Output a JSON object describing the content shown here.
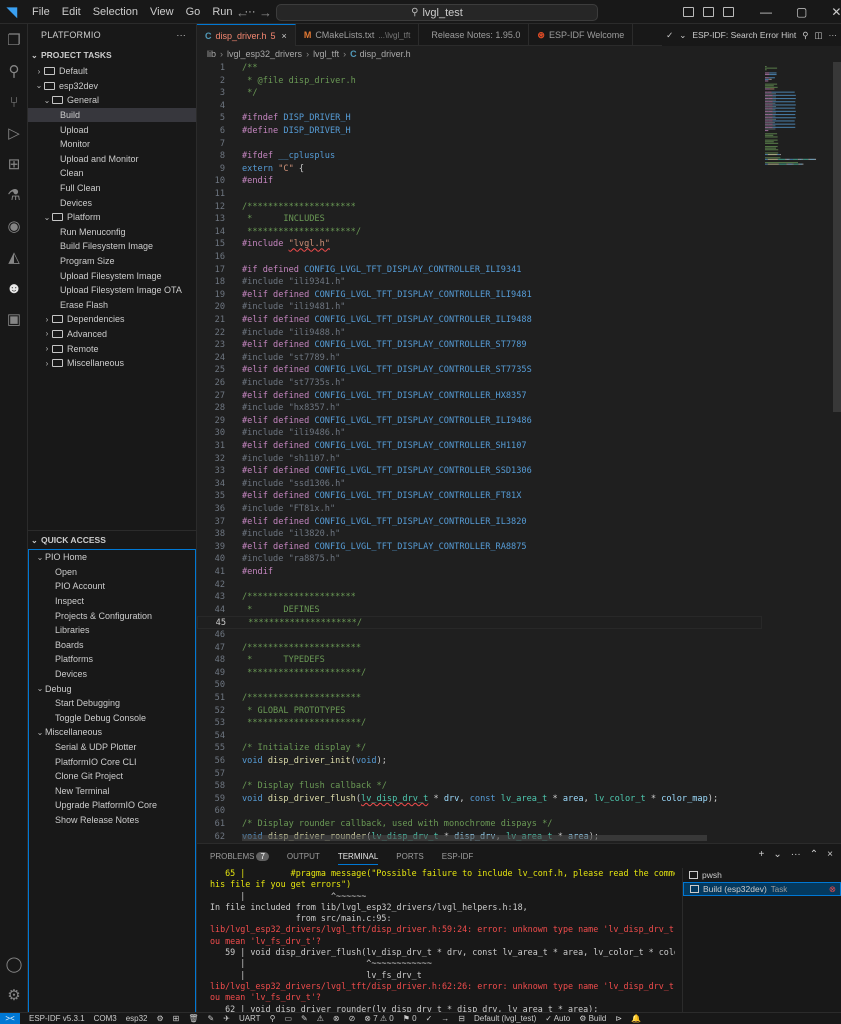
{
  "titlebar": {
    "menus": [
      "File",
      "Edit",
      "Selection",
      "View",
      "Go",
      "Run"
    ],
    "more": "···",
    "search": "lvgl_test"
  },
  "sidebar": {
    "title": "PLATFORMIO",
    "more": "···",
    "project_tasks": {
      "title": "PROJECT TASKS",
      "items": [
        {
          "label": "Default",
          "level": 1,
          "chev": "›",
          "folder": true
        },
        {
          "label": "esp32dev",
          "level": 1,
          "chev": "⌄",
          "folder": true
        },
        {
          "label": "General",
          "level": 2,
          "chev": "⌄",
          "folder": true
        },
        {
          "label": "Build",
          "level": 3,
          "chev": "",
          "folder": false,
          "selected": true
        },
        {
          "label": "Upload",
          "level": 3,
          "chev": "",
          "folder": false
        },
        {
          "label": "Monitor",
          "level": 3,
          "chev": "",
          "folder": false
        },
        {
          "label": "Upload and Monitor",
          "level": 3,
          "chev": "",
          "folder": false
        },
        {
          "label": "Clean",
          "level": 3,
          "chev": "",
          "folder": false
        },
        {
          "label": "Full Clean",
          "level": 3,
          "chev": "",
          "folder": false
        },
        {
          "label": "Devices",
          "level": 3,
          "chev": "",
          "folder": false
        },
        {
          "label": "Platform",
          "level": 2,
          "chev": "⌄",
          "folder": true
        },
        {
          "label": "Run Menuconfig",
          "level": 3,
          "chev": "",
          "folder": false
        },
        {
          "label": "Build Filesystem Image",
          "level": 3,
          "chev": "",
          "folder": false
        },
        {
          "label": "Program Size",
          "level": 3,
          "chev": "",
          "folder": false
        },
        {
          "label": "Upload Filesystem Image",
          "level": 3,
          "chev": "",
          "folder": false
        },
        {
          "label": "Upload Filesystem Image OTA",
          "level": 3,
          "chev": "",
          "folder": false
        },
        {
          "label": "Erase Flash",
          "level": 3,
          "chev": "",
          "folder": false
        },
        {
          "label": "Dependencies",
          "level": 2,
          "chev": "›",
          "folder": true
        },
        {
          "label": "Advanced",
          "level": 2,
          "chev": "›",
          "folder": true
        },
        {
          "label": "Remote",
          "level": 2,
          "chev": "›",
          "folder": true
        },
        {
          "label": "Miscellaneous",
          "level": 2,
          "chev": "›",
          "folder": true
        }
      ]
    },
    "quick_access": {
      "title": "QUICK ACCESS",
      "items": [
        {
          "label": "PIO Home",
          "level": 1,
          "chev": "⌄"
        },
        {
          "label": "Open",
          "level": 2,
          "chev": ""
        },
        {
          "label": "PIO Account",
          "level": 2,
          "chev": ""
        },
        {
          "label": "Inspect",
          "level": 2,
          "chev": ""
        },
        {
          "label": "Projects & Configuration",
          "level": 2,
          "chev": ""
        },
        {
          "label": "Libraries",
          "level": 2,
          "chev": ""
        },
        {
          "label": "Boards",
          "level": 2,
          "chev": ""
        },
        {
          "label": "Platforms",
          "level": 2,
          "chev": ""
        },
        {
          "label": "Devices",
          "level": 2,
          "chev": ""
        },
        {
          "label": "Debug",
          "level": 1,
          "chev": "⌄"
        },
        {
          "label": "Start Debugging",
          "level": 2,
          "chev": ""
        },
        {
          "label": "Toggle Debug Console",
          "level": 2,
          "chev": ""
        },
        {
          "label": "Miscellaneous",
          "level": 1,
          "chev": "⌄"
        },
        {
          "label": "Serial & UDP Plotter",
          "level": 2,
          "chev": ""
        },
        {
          "label": "PlatformIO Core CLI",
          "level": 2,
          "chev": ""
        },
        {
          "label": "Clone Git Project",
          "level": 2,
          "chev": ""
        },
        {
          "label": "New Terminal",
          "level": 2,
          "chev": ""
        },
        {
          "label": "Upgrade PlatformIO Core",
          "level": 2,
          "chev": ""
        },
        {
          "label": "Show Release Notes",
          "level": 2,
          "chev": ""
        }
      ]
    }
  },
  "tabs": [
    {
      "icon": "C",
      "icon_color": "#519aba",
      "label": "disp_driver.h",
      "badge": "5",
      "desc": "",
      "active": true,
      "close": "×"
    },
    {
      "icon": "M",
      "icon_color": "#e37933",
      "label": "CMakeLists.txt",
      "badge": "",
      "desc": "...\\lvgl_tft",
      "active": false,
      "close": ""
    },
    {
      "icon": "",
      "icon_color": "#cccccc",
      "label": "Release Notes: 1.95.0",
      "badge": "",
      "desc": "",
      "active": false,
      "close": ""
    },
    {
      "icon": "",
      "icon_color": "#e34c26",
      "label": "ESP-IDF Welcome",
      "badge": "",
      "desc": "",
      "active": false,
      "close": ""
    }
  ],
  "tab_actions": {
    "label": "ESP-IDF: Search Error Hint"
  },
  "breadcrumb": [
    "lib",
    "lvgl_esp32_drivers",
    "lvgl_tft",
    "disp_driver.h"
  ],
  "breadcrumb_sep": "›",
  "editor": {
    "current_line": 45,
    "lines": [
      [
        {
          "t": "/**",
          "c": "com"
        }
      ],
      [
        {
          "t": " * @file disp_driver.h",
          "c": "com"
        }
      ],
      [
        {
          "t": " */",
          "c": "com"
        }
      ],
      [],
      [
        {
          "t": "#ifndef ",
          "c": "pp"
        },
        {
          "t": "DISP_DRIVER_H",
          "c": "mac"
        }
      ],
      [
        {
          "t": "#define ",
          "c": "pp"
        },
        {
          "t": "DISP_DRIVER_H",
          "c": "mac"
        }
      ],
      [],
      [
        {
          "t": "#ifdef ",
          "c": "pp"
        },
        {
          "t": "__cplusplus",
          "c": "mac"
        }
      ],
      [
        {
          "t": "extern ",
          "c": "kw"
        },
        {
          "t": "\"C\"",
          "c": "str"
        },
        {
          "t": " {",
          "c": "plain"
        }
      ],
      [
        {
          "t": "#endif",
          "c": "pp"
        }
      ],
      [],
      [
        {
          "t": "/*********************",
          "c": "com"
        }
      ],
      [
        {
          "t": " *      INCLUDES",
          "c": "com"
        }
      ],
      [
        {
          "t": " *********************/",
          "c": "com"
        }
      ],
      [
        {
          "t": "#include ",
          "c": "pp"
        },
        {
          "t": "\"lvgl.h\"",
          "c": "str",
          "sq": true
        }
      ],
      [],
      [
        {
          "t": "#if ",
          "c": "pp"
        },
        {
          "t": "defined ",
          "c": "pp"
        },
        {
          "t": "CONFIG_LVGL_TFT_DISPLAY_CONTROLLER_ILI9341",
          "c": "mac"
        }
      ],
      [
        {
          "t": "#include \"ili9341.h\"",
          "c": "inc"
        }
      ],
      [
        {
          "t": "#elif ",
          "c": "pp"
        },
        {
          "t": "defined ",
          "c": "pp"
        },
        {
          "t": "CONFIG_LVGL_TFT_DISPLAY_CONTROLLER_ILI9481",
          "c": "mac"
        }
      ],
      [
        {
          "t": "#include \"ili9481.h\"",
          "c": "inc"
        }
      ],
      [
        {
          "t": "#elif ",
          "c": "pp"
        },
        {
          "t": "defined ",
          "c": "pp"
        },
        {
          "t": "CONFIG_LVGL_TFT_DISPLAY_CONTROLLER_ILI9488",
          "c": "mac"
        }
      ],
      [
        {
          "t": "#include \"ili9488.h\"",
          "c": "inc"
        }
      ],
      [
        {
          "t": "#elif ",
          "c": "pp"
        },
        {
          "t": "defined ",
          "c": "pp"
        },
        {
          "t": "CONFIG_LVGL_TFT_DISPLAY_CONTROLLER_ST7789",
          "c": "mac"
        }
      ],
      [
        {
          "t": "#include \"st7789.h\"",
          "c": "inc"
        }
      ],
      [
        {
          "t": "#elif ",
          "c": "pp"
        },
        {
          "t": "defined ",
          "c": "pp"
        },
        {
          "t": "CONFIG_LVGL_TFT_DISPLAY_CONTROLLER_ST7735S",
          "c": "mac"
        }
      ],
      [
        {
          "t": "#include \"st7735s.h\"",
          "c": "inc"
        }
      ],
      [
        {
          "t": "#elif ",
          "c": "pp"
        },
        {
          "t": "defined ",
          "c": "pp"
        },
        {
          "t": "CONFIG_LVGL_TFT_DISPLAY_CONTROLLER_HX8357",
          "c": "mac"
        }
      ],
      [
        {
          "t": "#include \"hx8357.h\"",
          "c": "inc"
        }
      ],
      [
        {
          "t": "#elif ",
          "c": "pp"
        },
        {
          "t": "defined ",
          "c": "pp"
        },
        {
          "t": "CONFIG_LVGL_TFT_DISPLAY_CONTROLLER_ILI9486",
          "c": "mac"
        }
      ],
      [
        {
          "t": "#include \"ili9486.h\"",
          "c": "inc"
        }
      ],
      [
        {
          "t": "#elif ",
          "c": "pp"
        },
        {
          "t": "defined ",
          "c": "pp"
        },
        {
          "t": "CONFIG_LVGL_TFT_DISPLAY_CONTROLLER_SH1107",
          "c": "mac"
        }
      ],
      [
        {
          "t": "#include \"sh1107.h\"",
          "c": "inc"
        }
      ],
      [
        {
          "t": "#elif ",
          "c": "pp"
        },
        {
          "t": "defined ",
          "c": "pp"
        },
        {
          "t": "CONFIG_LVGL_TFT_DISPLAY_CONTROLLER_SSD1306",
          "c": "mac"
        }
      ],
      [
        {
          "t": "#include \"ssd1306.h\"",
          "c": "inc"
        }
      ],
      [
        {
          "t": "#elif ",
          "c": "pp"
        },
        {
          "t": "defined ",
          "c": "pp"
        },
        {
          "t": "CONFIG_LVGL_TFT_DISPLAY_CONTROLLER_FT81X",
          "c": "mac"
        }
      ],
      [
        {
          "t": "#include \"FT81x.h\"",
          "c": "inc"
        }
      ],
      [
        {
          "t": "#elif ",
          "c": "pp"
        },
        {
          "t": "defined ",
          "c": "pp"
        },
        {
          "t": "CONFIG_LVGL_TFT_DISPLAY_CONTROLLER_IL3820",
          "c": "mac"
        }
      ],
      [
        {
          "t": "#include \"il3820.h\"",
          "c": "inc"
        }
      ],
      [
        {
          "t": "#elif ",
          "c": "pp"
        },
        {
          "t": "defined ",
          "c": "pp"
        },
        {
          "t": "CONFIG_LVGL_TFT_DISPLAY_CONTROLLER_RA8875",
          "c": "mac"
        }
      ],
      [
        {
          "t": "#include \"ra8875.h\"",
          "c": "inc"
        }
      ],
      [
        {
          "t": "#endif",
          "c": "pp"
        }
      ],
      [],
      [
        {
          "t": "/*********************",
          "c": "com"
        }
      ],
      [
        {
          "t": " *      DEFINES",
          "c": "com"
        }
      ],
      [
        {
          "t": " *********************/",
          "c": "com"
        }
      ],
      [],
      [
        {
          "t": "/**********************",
          "c": "com"
        }
      ],
      [
        {
          "t": " *      TYPEDEFS",
          "c": "com"
        }
      ],
      [
        {
          "t": " **********************/",
          "c": "com"
        }
      ],
      [],
      [
        {
          "t": "/**********************",
          "c": "com"
        }
      ],
      [
        {
          "t": " * GLOBAL PROTOTYPES",
          "c": "com"
        }
      ],
      [
        {
          "t": " **********************/",
          "c": "com"
        }
      ],
      [],
      [
        {
          "t": "/* Initialize display */",
          "c": "com"
        }
      ],
      [
        {
          "t": "void ",
          "c": "kw"
        },
        {
          "t": "disp_driver_init",
          "c": "fn"
        },
        {
          "t": "(",
          "c": "plain"
        },
        {
          "t": "void",
          "c": "kw"
        },
        {
          "t": ");",
          "c": "plain"
        }
      ],
      [],
      [
        {
          "t": "/* Display flush callback */",
          "c": "com"
        }
      ],
      [
        {
          "t": "void ",
          "c": "kw"
        },
        {
          "t": "disp_driver_flush",
          "c": "fn"
        },
        {
          "t": "(",
          "c": "plain"
        },
        {
          "t": "lv_disp_drv_t",
          "c": "type",
          "sq": true
        },
        {
          "t": " * ",
          "c": "plain"
        },
        {
          "t": "drv",
          "c": "id"
        },
        {
          "t": ", ",
          "c": "plain"
        },
        {
          "t": "const ",
          "c": "kw"
        },
        {
          "t": "lv_area_t",
          "c": "type"
        },
        {
          "t": " * ",
          "c": "plain"
        },
        {
          "t": "area",
          "c": "id"
        },
        {
          "t": ", ",
          "c": "plain"
        },
        {
          "t": "lv_color_t",
          "c": "type"
        },
        {
          "t": " * ",
          "c": "plain"
        },
        {
          "t": "color_map",
          "c": "id"
        },
        {
          "t": ");",
          "c": "plain"
        }
      ],
      [],
      [
        {
          "t": "/* Display rounder callback, used with monochrome dispays */",
          "c": "com"
        }
      ],
      [
        {
          "t": "void ",
          "c": "kw"
        },
        {
          "t": "disp_driver_rounder",
          "c": "fn"
        },
        {
          "t": "(",
          "c": "plain"
        },
        {
          "t": "lv_disp_drv_t",
          "c": "type"
        },
        {
          "t": " * ",
          "c": "plain"
        },
        {
          "t": "disp_drv",
          "c": "id"
        },
        {
          "t": ", ",
          "c": "plain"
        },
        {
          "t": "lv_area_t",
          "c": "type"
        },
        {
          "t": " * ",
          "c": "plain"
        },
        {
          "t": "area",
          "c": "id"
        },
        {
          "t": ");",
          "c": "plain"
        }
      ]
    ]
  },
  "panel": {
    "tabs": [
      {
        "label": "PROBLEMS",
        "badge": "7",
        "active": false
      },
      {
        "label": "OUTPUT",
        "badge": "",
        "active": false
      },
      {
        "label": "TERMINAL",
        "badge": "",
        "active": true
      },
      {
        "label": "PORTS",
        "badge": "",
        "active": false
      },
      {
        "label": "ESP-IDF",
        "badge": "",
        "active": false
      }
    ],
    "actions": [
      "+",
      "⌄",
      "···",
      "⌃",
      "×"
    ],
    "terminal_lines": [
      {
        "t": "   65 |         #pragma message(\"Possible failure to include lv_conf.h, please read the comment in t",
        "c": "warn"
      },
      {
        "t": "his file if you get errors\")",
        "c": "warn"
      },
      {
        "t": "      |                 ^~~~~~~",
        "c": "plain"
      },
      {
        "t": "In file included from lib/lvgl_esp32_drivers/lvgl_helpers.h:18,",
        "c": "plain"
      },
      {
        "t": "                 from src/main.c:95:",
        "c": "plain"
      },
      {
        "t": "lib/lvgl_esp32_drivers/lvgl_tft/disp_driver.h:59:24: error: unknown type name 'lv_disp_drv_t'; did y",
        "c": "err"
      },
      {
        "t": "ou mean 'lv_fs_drv_t'?",
        "c": "err"
      },
      {
        "t": "   59 | void disp_driver_flush(lv_disp_drv_t * drv, const lv_area_t * area, lv_color_t * color_map);",
        "c": "plain"
      },
      {
        "t": "      |                        ^~~~~~~~~~~~~",
        "c": "plain"
      },
      {
        "t": "      |                        lv_fs_drv_t",
        "c": "plain"
      },
      {
        "t": "lib/lvgl_esp32_drivers/lvgl_tft/disp_driver.h:62:26: error: unknown type name 'lv_disp_drv_t'; did y",
        "c": "err"
      },
      {
        "t": "ou mean 'lv_fs_drv_t'?",
        "c": "err"
      },
      {
        "t": "   62 | void disp_driver_rounder(lv_disp_drv_t * disp_drv, lv_area_t * area);",
        "c": "plain"
      }
    ],
    "terminal_list": [
      {
        "label": "pwsh",
        "task": "",
        "selected": false,
        "error": ""
      },
      {
        "label": "Build (esp32dev)",
        "task": "Task",
        "selected": true,
        "error": "⊗"
      }
    ]
  },
  "statusbar": {
    "remote": "><",
    "items": [
      "ESP-IDF v5.3.1",
      "COM3",
      "esp32",
      "⚙",
      "⊞",
      "🗑",
      "✎",
      "✈",
      "UART",
      "⚲",
      "▭",
      "✎",
      "⚠",
      "⊗",
      "⊘",
      "⊗ 7 ⚠ 0",
      "⚑ 0",
      "✓",
      "→",
      "⊟",
      "Default (lvgl_test)",
      "✓ Auto",
      "⚙ Build",
      "⊳",
      "🔔"
    ]
  }
}
